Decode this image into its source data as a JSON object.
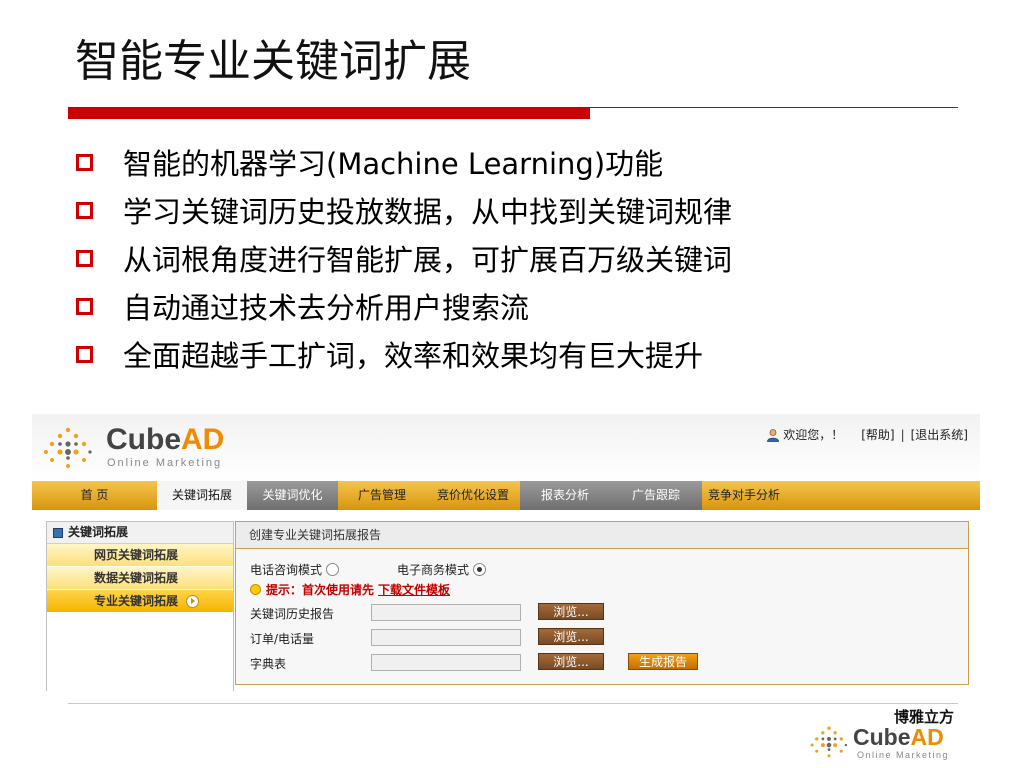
{
  "slide": {
    "title": "智能专业关键词扩展",
    "bullets": [
      "智能的机器学习(Machine Learning)功能",
      "学习关键词历史投放数据，从中找到关键词规律",
      "从词根角度进行智能扩展，可扩展百万级关键词",
      "自动通过技术去分析用户搜索流",
      "全面超越手工扩词，效率和效果均有巨大提升"
    ]
  },
  "app": {
    "logo": {
      "main": "Cube",
      "accent": "AD",
      "sub": "Online Marketing"
    },
    "user": {
      "welcome": "欢迎您，！",
      "help": "[帮助]",
      "sep": "|",
      "logout": "[退出系统]"
    },
    "nav": [
      "首 页",
      "关键词拓展",
      "关键词优化",
      "广告管理",
      "竞价优化设置",
      "报表分析",
      "广告跟踪",
      "竞争对手分析"
    ],
    "sidebar": {
      "heading": "关键词拓展",
      "items": [
        "网页关键词拓展",
        "数据关键词拓展",
        "专业关键词拓展"
      ]
    },
    "panel": {
      "title": "创建专业关键词拓展报告",
      "mode_phone": "电话咨询模式",
      "mode_ecommerce": "电子商务模式",
      "tip": "提示：首次使用请先",
      "tip_link": "下载文件模板",
      "fields": [
        "关键词历史报告",
        "订单/电话量",
        "字典表"
      ],
      "browse": "浏览...",
      "generate": "生成报告"
    },
    "colors": {
      "accent": "#f08a00",
      "red": "#cc0000"
    }
  },
  "footer": {
    "brand_cn": "博雅立方",
    "logo": {
      "main": "Cube",
      "accent": "AD",
      "sub": "Online Marketing"
    }
  }
}
